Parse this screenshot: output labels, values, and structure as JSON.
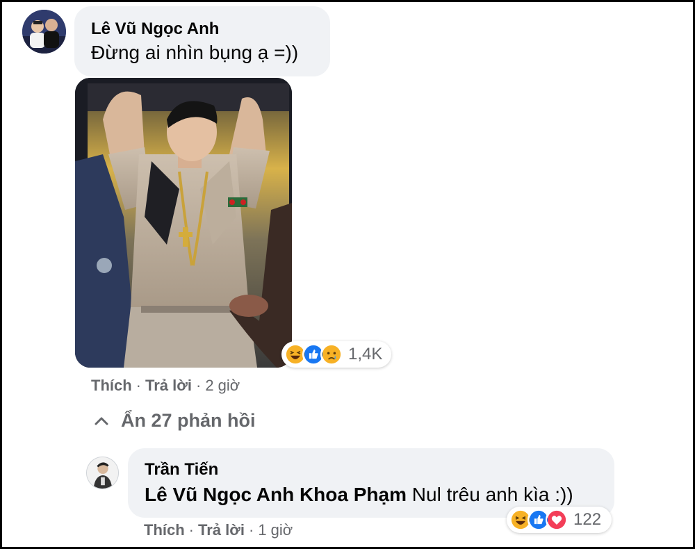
{
  "colors": {
    "bubble_bg": "#f0f2f5",
    "secondary_text": "#65676b",
    "like_blue": "#1877f2",
    "haha_yellow": "#f7b125",
    "love_red": "#f33e58"
  },
  "comment": {
    "author": "Lê Vũ Ngọc Anh",
    "text": "Đừng ai nhìn bụng ạ =))",
    "reactions": {
      "icons": [
        "haha-icon",
        "like-icon",
        "sad-icon"
      ],
      "count": "1,4K"
    },
    "actions": {
      "like": "Thích",
      "separator": "·",
      "reply": "Trả lời",
      "time": "2 giờ"
    }
  },
  "hide_replies": "Ẩn 27 phản hồi",
  "reply": {
    "author": "Trần Tiến",
    "mention": "Lê Vũ Ngọc Anh Khoa Phạm",
    "text": " Nul trêu anh kìa :))",
    "reactions": {
      "icons": [
        "haha-icon",
        "like-icon",
        "love-icon"
      ],
      "count": "122"
    },
    "actions": {
      "like": "Thích",
      "separator": "·",
      "reply": "Trả lời",
      "time": "1 giờ"
    }
  }
}
